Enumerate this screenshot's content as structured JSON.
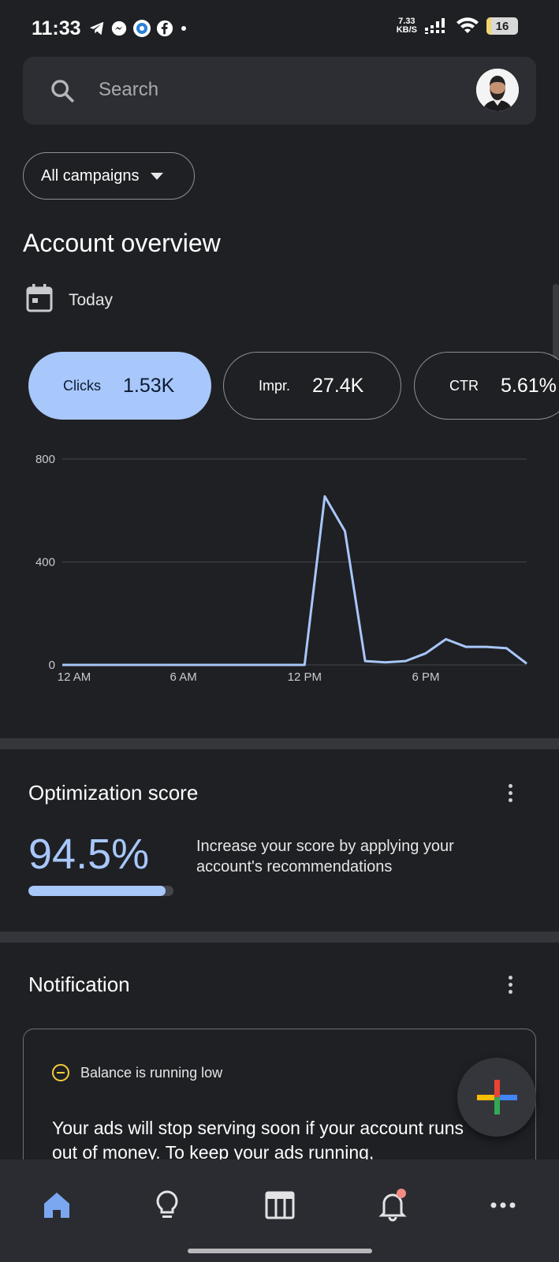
{
  "status_bar": {
    "time": "11:33",
    "network_speed_value": "7.33",
    "network_speed_unit": "KB/S",
    "battery": "16",
    "left_icons": [
      "telegram-icon",
      "messenger-icon",
      "app-icon",
      "facebook-icon",
      "dot-icon"
    ],
    "right_icons": [
      "signal-icon",
      "wifi-icon",
      "battery-icon"
    ]
  },
  "search": {
    "placeholder": "Search",
    "icon": "search-icon"
  },
  "campaign_filter": {
    "selected": "All campaigns"
  },
  "overview": {
    "title": "Account overview",
    "date_range": "Today",
    "metrics": [
      {
        "label": "Clicks",
        "value": "1.53K",
        "active": true
      },
      {
        "label": "Impr.",
        "value": "27.4K",
        "active": false
      },
      {
        "label": "CTR",
        "value": "5.61%",
        "active": false
      }
    ]
  },
  "chart_data": {
    "type": "line",
    "title": "",
    "xlabel": "",
    "ylabel": "",
    "x_tick_labels": [
      "12 AM",
      "6 AM",
      "12 PM",
      "6 PM"
    ],
    "y_tick_labels": [
      "800",
      "400",
      "0"
    ],
    "ylim": [
      0,
      800
    ],
    "xlim": [
      0,
      23
    ],
    "grid": true,
    "series": [
      {
        "color": "#a8c7fa",
        "x": [
          0,
          1,
          2,
          3,
          4,
          5,
          6,
          7,
          8,
          9,
          10,
          11,
          12,
          13,
          14,
          15,
          16,
          17,
          18,
          19,
          20,
          21,
          22,
          23
        ],
        "values": [
          0,
          0,
          0,
          0,
          0,
          0,
          0,
          0,
          0,
          0,
          0,
          0,
          0,
          655,
          520,
          15,
          10,
          15,
          45,
          100,
          70,
          70,
          65,
          5
        ]
      }
    ]
  },
  "optimization": {
    "title": "Optimization score",
    "score": "94.5%",
    "score_fraction": 0.945,
    "description": "Increase your score by applying your account's recommendations"
  },
  "notification": {
    "title": "Notification",
    "header": "Balance is running low",
    "body": "Your ads will stop serving soon if your account runs out of money. To keep your ads running,"
  },
  "bottom_nav": {
    "items": [
      "home-icon",
      "lightbulb-icon",
      "campaigns-icon",
      "notifications-icon",
      "more-icon"
    ]
  },
  "colors": {
    "accent": "#a8c7fa",
    "background": "#1f2024",
    "warning": "#f6cd3c",
    "badge": "#f28b82"
  }
}
